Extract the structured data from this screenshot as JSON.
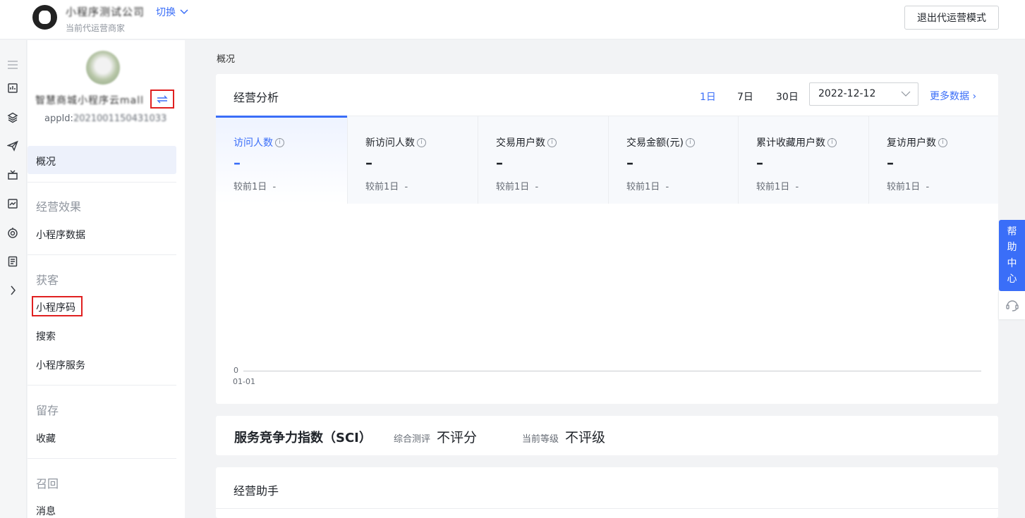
{
  "header": {
    "merchant_name": "小程序测试公司",
    "switch_label": "切换",
    "merchant_sub": "当前代运营商家",
    "exit_button": "退出代运营模式"
  },
  "rail": {
    "icons": [
      "menu-icon",
      "chart-icon",
      "cube-icon",
      "send-icon",
      "gift-icon",
      "trend-icon",
      "target-icon",
      "document-icon",
      "chevron-right-icon"
    ]
  },
  "sidebar": {
    "app_name": "智慧商城小程序云mall",
    "app_id_prefix": "appId:",
    "app_id_value": "2021001150431033",
    "items": [
      {
        "type": "item",
        "label": "概况",
        "active": true
      },
      {
        "type": "group",
        "label": "经营效果"
      },
      {
        "type": "item",
        "label": "小程序数据"
      },
      {
        "type": "group",
        "label": "获客"
      },
      {
        "type": "item",
        "label": "小程序码",
        "highlighted": true
      },
      {
        "type": "item",
        "label": "搜索"
      },
      {
        "type": "item",
        "label": "小程序服务"
      },
      {
        "type": "group",
        "label": "留存"
      },
      {
        "type": "item",
        "label": "收藏"
      },
      {
        "type": "group",
        "label": "召回"
      },
      {
        "type": "item",
        "label": "消息"
      }
    ]
  },
  "breadcrumb": "概况",
  "analysis": {
    "title": "经营分析",
    "periods": [
      "1日",
      "7日",
      "30日"
    ],
    "active_period": "1日",
    "date": "2022-12-12",
    "more_data": "更多数据",
    "metrics": [
      {
        "label": "访问人数",
        "value": "–",
        "compare_label": "较前1日",
        "compare_value": "-"
      },
      {
        "label": "新访问人数",
        "value": "–",
        "compare_label": "较前1日",
        "compare_value": "-"
      },
      {
        "label": "交易用户数",
        "value": "–",
        "compare_label": "较前1日",
        "compare_value": "-"
      },
      {
        "label": "交易金额(元)",
        "value": "–",
        "compare_label": "较前1日",
        "compare_value": "-"
      },
      {
        "label": "累计收藏用户数",
        "value": "–",
        "compare_label": "较前1日",
        "compare_value": "-"
      },
      {
        "label": "复访用户数",
        "value": "–",
        "compare_label": "较前1日",
        "compare_value": "-"
      }
    ],
    "chart": {
      "y_tick": "0",
      "x_tick": "01-01"
    }
  },
  "sci": {
    "title": "服务竞争力指数（SCI）",
    "eval_label": "综合测评",
    "eval_value": "不评分",
    "level_label": "当前等级",
    "level_value": "不评级"
  },
  "assistant": {
    "title": "经营助手"
  },
  "help": {
    "label_chars": [
      "帮",
      "助",
      "中",
      "心"
    ]
  },
  "colors": {
    "accent": "#3a6ef8",
    "highlight": "#e02020"
  }
}
